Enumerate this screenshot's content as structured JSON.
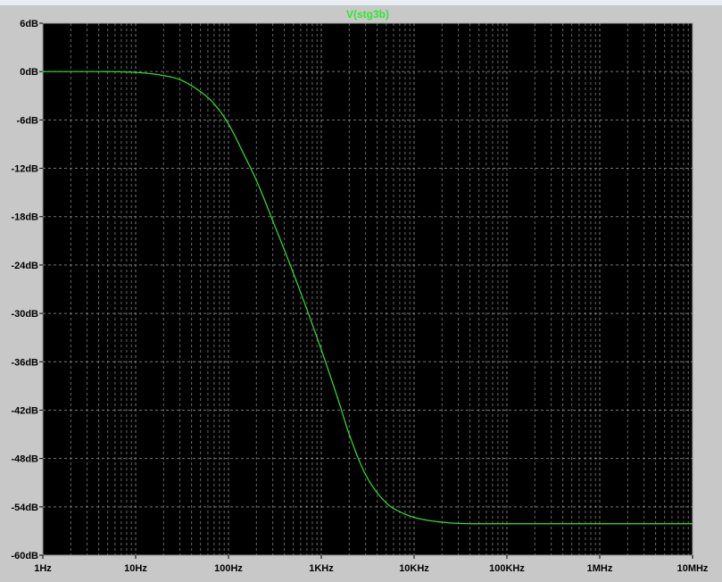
{
  "window": {
    "background": "#c8c8c8"
  },
  "chart_data": {
    "type": "line",
    "title": "",
    "xlabel": "",
    "ylabel": "",
    "x_scale": "log",
    "xlim": [
      1,
      10000000
    ],
    "ylim": [
      -60,
      6
    ],
    "grid": true,
    "plot_background": "#000000",
    "grid_color": "#8a8a8a",
    "x_tick_values": [
      1,
      10,
      100,
      1000,
      10000,
      100000,
      1000000,
      10000000
    ],
    "x_tick_labels": [
      "1Hz",
      "10Hz",
      "100Hz",
      "1KHz",
      "10KHz",
      "100KHz",
      "1MHz",
      "10MHz"
    ],
    "y_tick_values": [
      6,
      0,
      -6,
      -12,
      -18,
      -24,
      -30,
      -36,
      -42,
      -48,
      -54,
      -60
    ],
    "y_tick_labels": [
      "6dB",
      "0dB",
      "-6dB",
      "-12dB",
      "-18dB",
      "-24dB",
      "-30dB",
      "-36dB",
      "-42dB",
      "-48dB",
      "-54dB",
      "-60dB"
    ],
    "series": [
      {
        "name": "V(stg3b)",
        "color": "#2ee82e",
        "x": [
          1,
          3,
          10,
          20,
          30,
          50,
          70,
          100,
          150,
          200,
          300,
          500,
          700,
          1000,
          1500,
          2000,
          3000,
          5000,
          7000,
          10000,
          20000,
          50000,
          100000,
          1000000,
          10000000
        ],
        "y": [
          0,
          0,
          -0.1,
          -0.5,
          -1,
          -2.5,
          -4,
          -6.5,
          -10.5,
          -13.5,
          -18.5,
          -25,
          -29.5,
          -34.5,
          -40.5,
          -45,
          -50,
          -53.5,
          -54.6,
          -55.3,
          -55.9,
          -56.1,
          -56.1,
          -56.1,
          -56.1
        ]
      }
    ]
  }
}
